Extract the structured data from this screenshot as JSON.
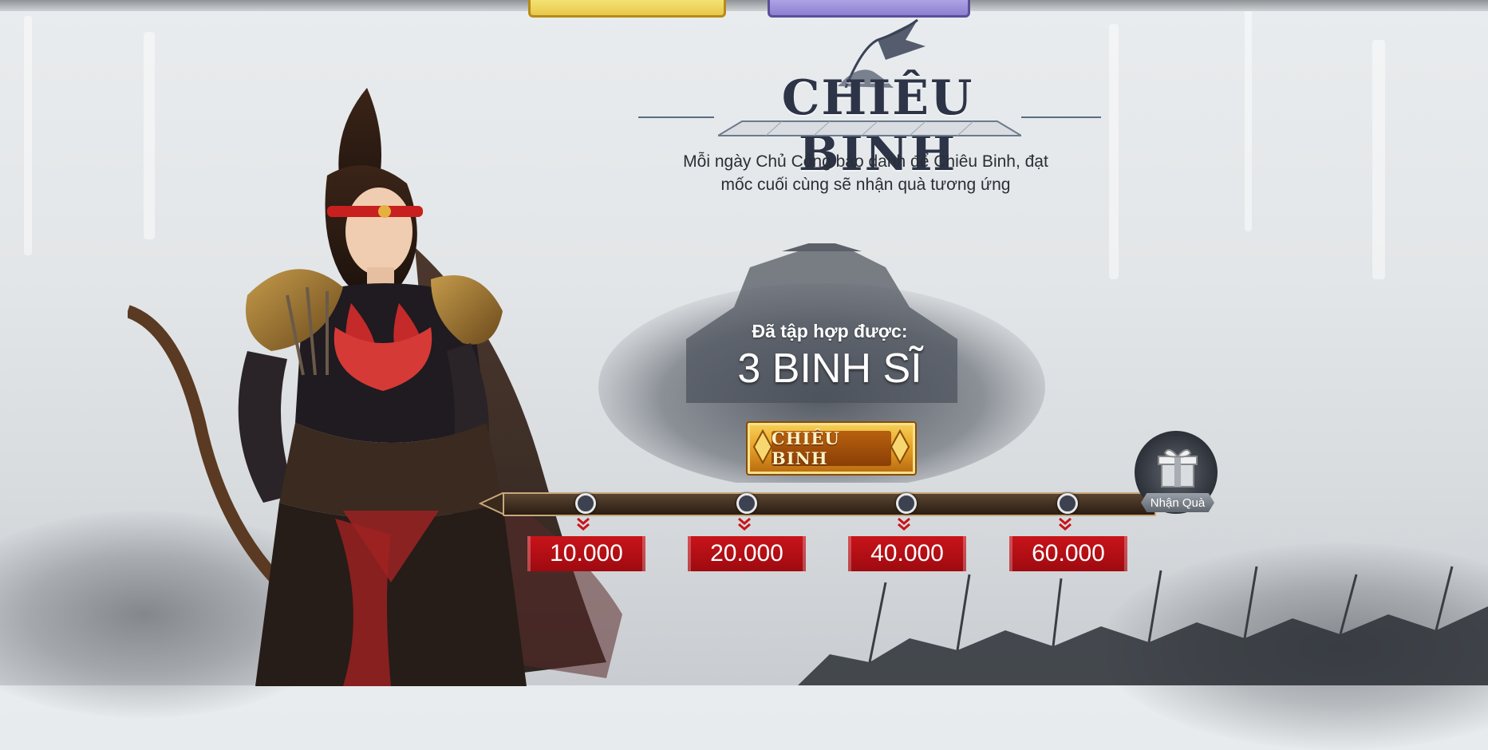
{
  "page": {
    "title": "CHIÊU BINH",
    "description": "Mỗi ngày Chủ Công báo danh để Chiêu Binh, đạt mốc cuối cùng sẽ nhận quà tương ứng",
    "description_line1": "Mỗi ngày Chủ Công báo danh để Chiêu Binh, đạt",
    "description_line2": "mốc cuối cùng sẽ nhận quà tương ứng"
  },
  "progress": {
    "collected_label": "Đã tập hợp được:",
    "collected_count": "3 BINH SĨ",
    "milestones": [
      "10.000",
      "20.000",
      "40.000",
      "60.000"
    ]
  },
  "buttons": {
    "recruit": "CHIÊU BINH",
    "claim_reward": "Nhận Quà"
  },
  "colors": {
    "accent_gold": "#e7a42a",
    "milestone_red": "#c8141a",
    "title_navy": "#2d3447"
  },
  "icons": {
    "recruit_button_ornament": "gold-diamond-ornament-icon",
    "gift": "gift-box-icon",
    "milestone_marker": "double-chevron-down-icon",
    "title_emblem": "banner-flag-icon"
  }
}
